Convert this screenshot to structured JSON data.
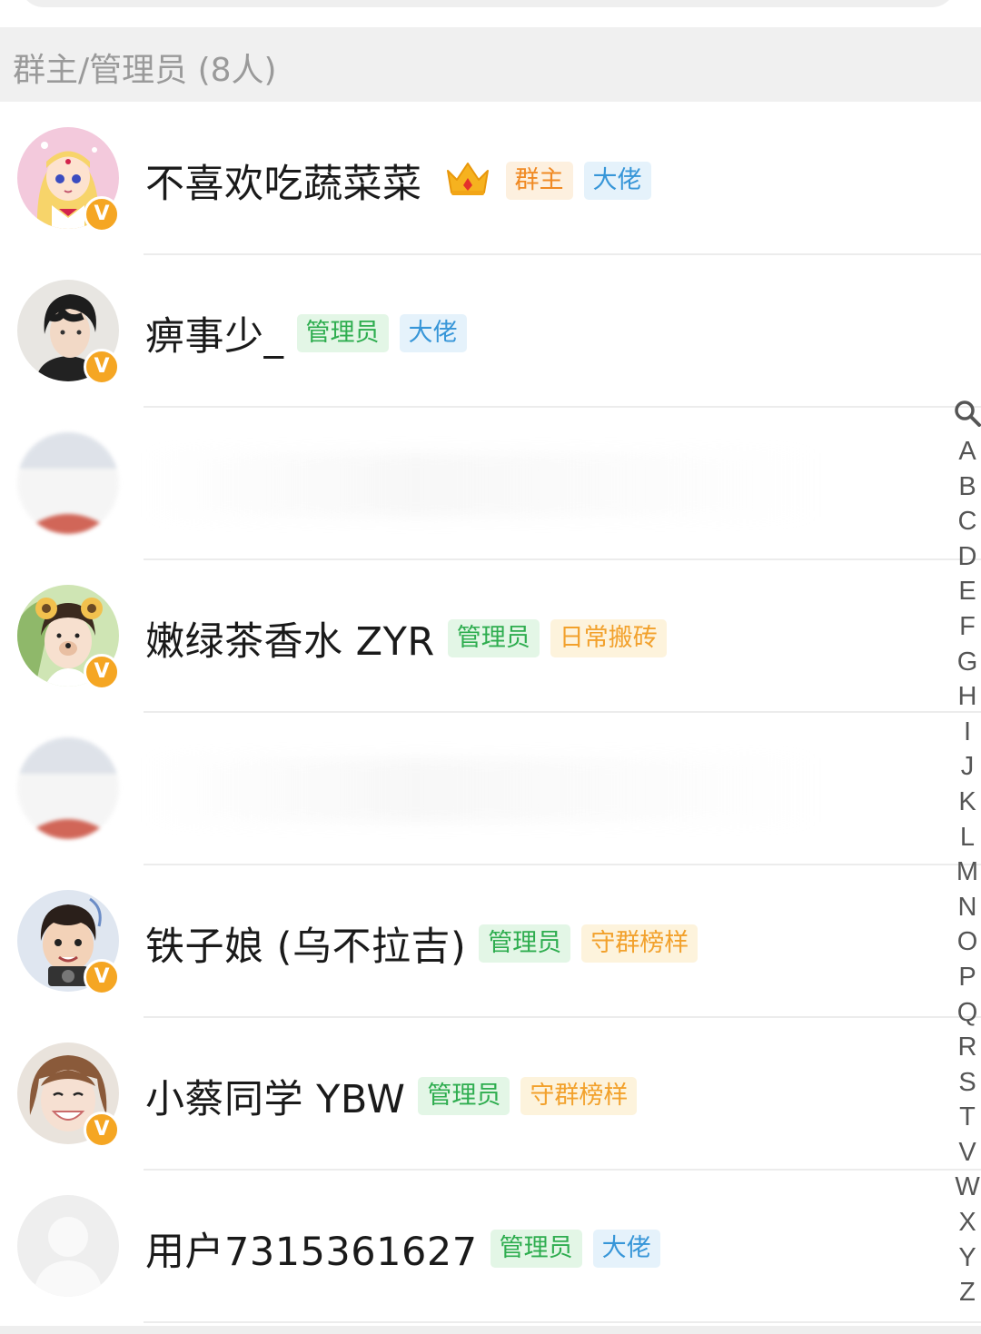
{
  "section": {
    "title": "群主/管理员 (8人)"
  },
  "members": [
    {
      "name": "不喜欢吃蔬菜菜",
      "crown": true,
      "tags": [
        {
          "label": "群主",
          "style": "owner"
        },
        {
          "label": "大佬",
          "style": "boss"
        }
      ],
      "avatar": "sailor-moon"
    },
    {
      "name": "痹事少_",
      "crown": false,
      "tags": [
        {
          "label": "管理员",
          "style": "admin"
        },
        {
          "label": "大佬",
          "style": "boss"
        }
      ],
      "avatar": "dark-hair-boy"
    },
    {
      "name": "",
      "crown": false,
      "tags": [],
      "avatar": "redacted",
      "redacted": true
    },
    {
      "name": "嫩绿茶香水 ZYR",
      "crown": false,
      "tags": [
        {
          "label": "管理员",
          "style": "admin"
        },
        {
          "label": "日常搬砖",
          "style": "gold"
        }
      ],
      "avatar": "bear-ears-boy"
    },
    {
      "name": "",
      "crown": false,
      "tags": [],
      "avatar": "redacted",
      "redacted": true
    },
    {
      "name": "铁子娘 (乌不拉吉)",
      "crown": false,
      "tags": [
        {
          "label": "管理员",
          "style": "admin"
        },
        {
          "label": "守群榜样",
          "style": "gold"
        }
      ],
      "avatar": "child"
    },
    {
      "name": "小蔡同学 YBW",
      "crown": false,
      "tags": [
        {
          "label": "管理员",
          "style": "admin"
        },
        {
          "label": "守群榜样",
          "style": "gold"
        }
      ],
      "avatar": "smiling-girl"
    },
    {
      "name": "用户7315361627",
      "crown": false,
      "tags": [
        {
          "label": "管理员",
          "style": "admin"
        },
        {
          "label": "大佬",
          "style": "boss"
        }
      ],
      "avatar": "default-user"
    }
  ],
  "badge_letter": "V",
  "index_letters": [
    "A",
    "B",
    "C",
    "D",
    "E",
    "F",
    "G",
    "H",
    "I",
    "J",
    "K",
    "L",
    "M",
    "N",
    "O",
    "P",
    "Q",
    "R",
    "S",
    "T",
    "V",
    "W",
    "X",
    "Y",
    "Z"
  ],
  "colors": {
    "owner": "#f08a24",
    "admin": "#2ead4f",
    "boss": "#3796d8",
    "gold": "#f2a12c",
    "vbadge": "#f5a623"
  }
}
